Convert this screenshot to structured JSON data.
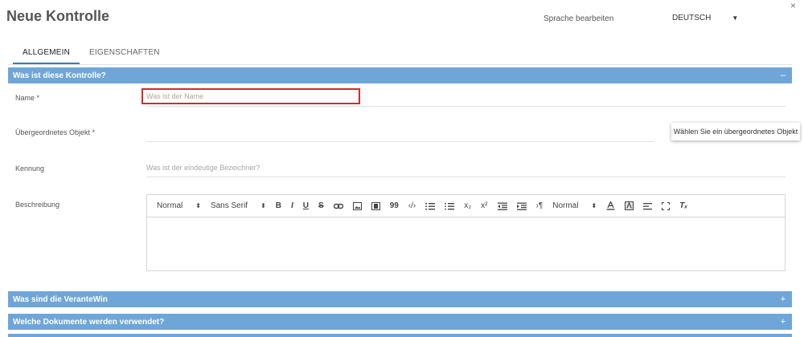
{
  "header": {
    "title": "Neue Kontrolle",
    "language_label": "Sprache bearbeiten",
    "language_value": "DEUTSCH",
    "close_symbol": "×"
  },
  "tabs": [
    {
      "label": "ALLGEMEIN",
      "active": true
    },
    {
      "label": "EIGENSCHAFTEN",
      "active": false
    }
  ],
  "sections": [
    {
      "title": "Was ist diese Kontrolle?",
      "sign": "–"
    },
    {
      "title": "Was sind die VeranteWin",
      "sign": "+"
    },
    {
      "title": "Welche Dokumente werden verwendet?",
      "sign": "+"
    }
  ],
  "fields": {
    "name": {
      "label": "Name *",
      "placeholder": "Was ist der Name"
    },
    "parent": {
      "label": "Übergeordnetes Objekt *",
      "tooltip": "Wählen Sie ein übergeordnetes Objekt"
    },
    "identifier": {
      "label": "Kennung",
      "placeholder": "Was ist der eindeutige Bezeichner?"
    },
    "description": {
      "label": "Beschreibung"
    }
  },
  "editor_toolbar": {
    "format": "Normal",
    "font": "Sans Serif",
    "bold": "B",
    "italic": "I",
    "underline": "U",
    "strike": "S",
    "quote": "99",
    "code": "‹/›",
    "subscript": "x₂",
    "superscript": "x²",
    "rtl": "›¶",
    "size": "Normal",
    "clear": "Tₓ"
  },
  "colors": {
    "section_bar": "#6fa6d9",
    "tab_active_underline": "#2f7fbf",
    "focus_border": "#d42a2a"
  }
}
